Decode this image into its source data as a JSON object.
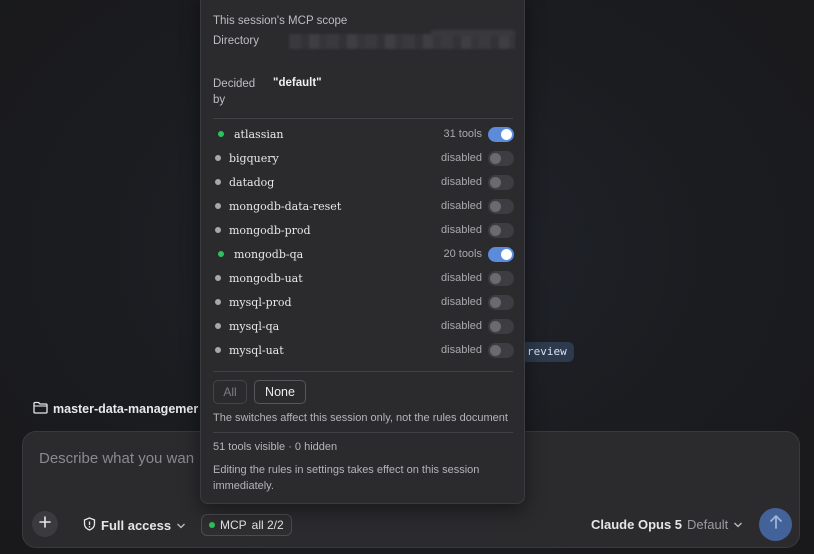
{
  "behind": {
    "review_chip": "review",
    "folder_name": "master-data-managemer"
  },
  "composer": {
    "placeholder": "Describe what you wan",
    "access_label": "Full access",
    "mcp_label": "MCP",
    "mcp_count": "all 2/2",
    "model_name": "Claude Opus 5",
    "model_variant": "Default"
  },
  "popup": {
    "title": "This session's MCP scope",
    "directory_label": "Directory",
    "decided_label_1": "Decided",
    "decided_label_2": "by",
    "decided_value": "\"default\"",
    "servers": [
      {
        "name": "atlassian",
        "status": "31 tools",
        "enabled": true
      },
      {
        "name": "bigquery",
        "status": "disabled",
        "enabled": false
      },
      {
        "name": "datadog",
        "status": "disabled",
        "enabled": false
      },
      {
        "name": "mongodb-data-reset",
        "status": "disabled",
        "enabled": false
      },
      {
        "name": "mongodb-prod",
        "status": "disabled",
        "enabled": false
      },
      {
        "name": "mongodb-qa",
        "status": "20 tools",
        "enabled": true
      },
      {
        "name": "mongodb-uat",
        "status": "disabled",
        "enabled": false
      },
      {
        "name": "mysql-prod",
        "status": "disabled",
        "enabled": false
      },
      {
        "name": "mysql-qa",
        "status": "disabled",
        "enabled": false
      },
      {
        "name": "mysql-uat",
        "status": "disabled",
        "enabled": false
      }
    ],
    "all_button": "All",
    "none_button": "None",
    "switch_note": "The switches affect this session only, not the rules document",
    "visible_count": "51 tools visible · 0 hidden",
    "settings_note": "Editing the rules in settings takes effect on this session immediately."
  },
  "colors": {
    "accent": "#5b8bd9",
    "enabled_dot": "#2ec25e",
    "disabled_dot": "#a7a7ab",
    "send_button": "#43629a"
  }
}
